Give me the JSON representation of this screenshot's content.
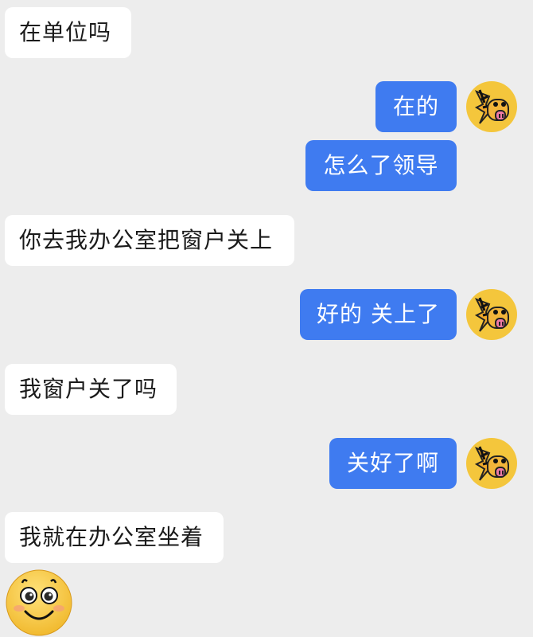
{
  "messages": [
    {
      "side": "in",
      "text": "在单位吗"
    },
    {
      "side": "out",
      "text": "在的"
    },
    {
      "side": "out",
      "text": "怎么了领导"
    },
    {
      "side": "in",
      "text": "你去我办公室把窗户关上"
    },
    {
      "side": "out",
      "text": "好的 关上了"
    },
    {
      "side": "in",
      "text": "我窗户关了吗"
    },
    {
      "side": "out",
      "text": "关好了啊"
    },
    {
      "side": "in",
      "text": "我就在办公室坐着"
    }
  ],
  "avatars": {
    "self": "horse-avatar-icon",
    "sticker": "smiley-face-icon"
  },
  "colors": {
    "background": "#ededed",
    "incoming_bubble": "#ffffff",
    "outgoing_bubble": "#3f7bf0",
    "outgoing_text": "#ffffff",
    "avatar_bg": "#f4c63c"
  }
}
